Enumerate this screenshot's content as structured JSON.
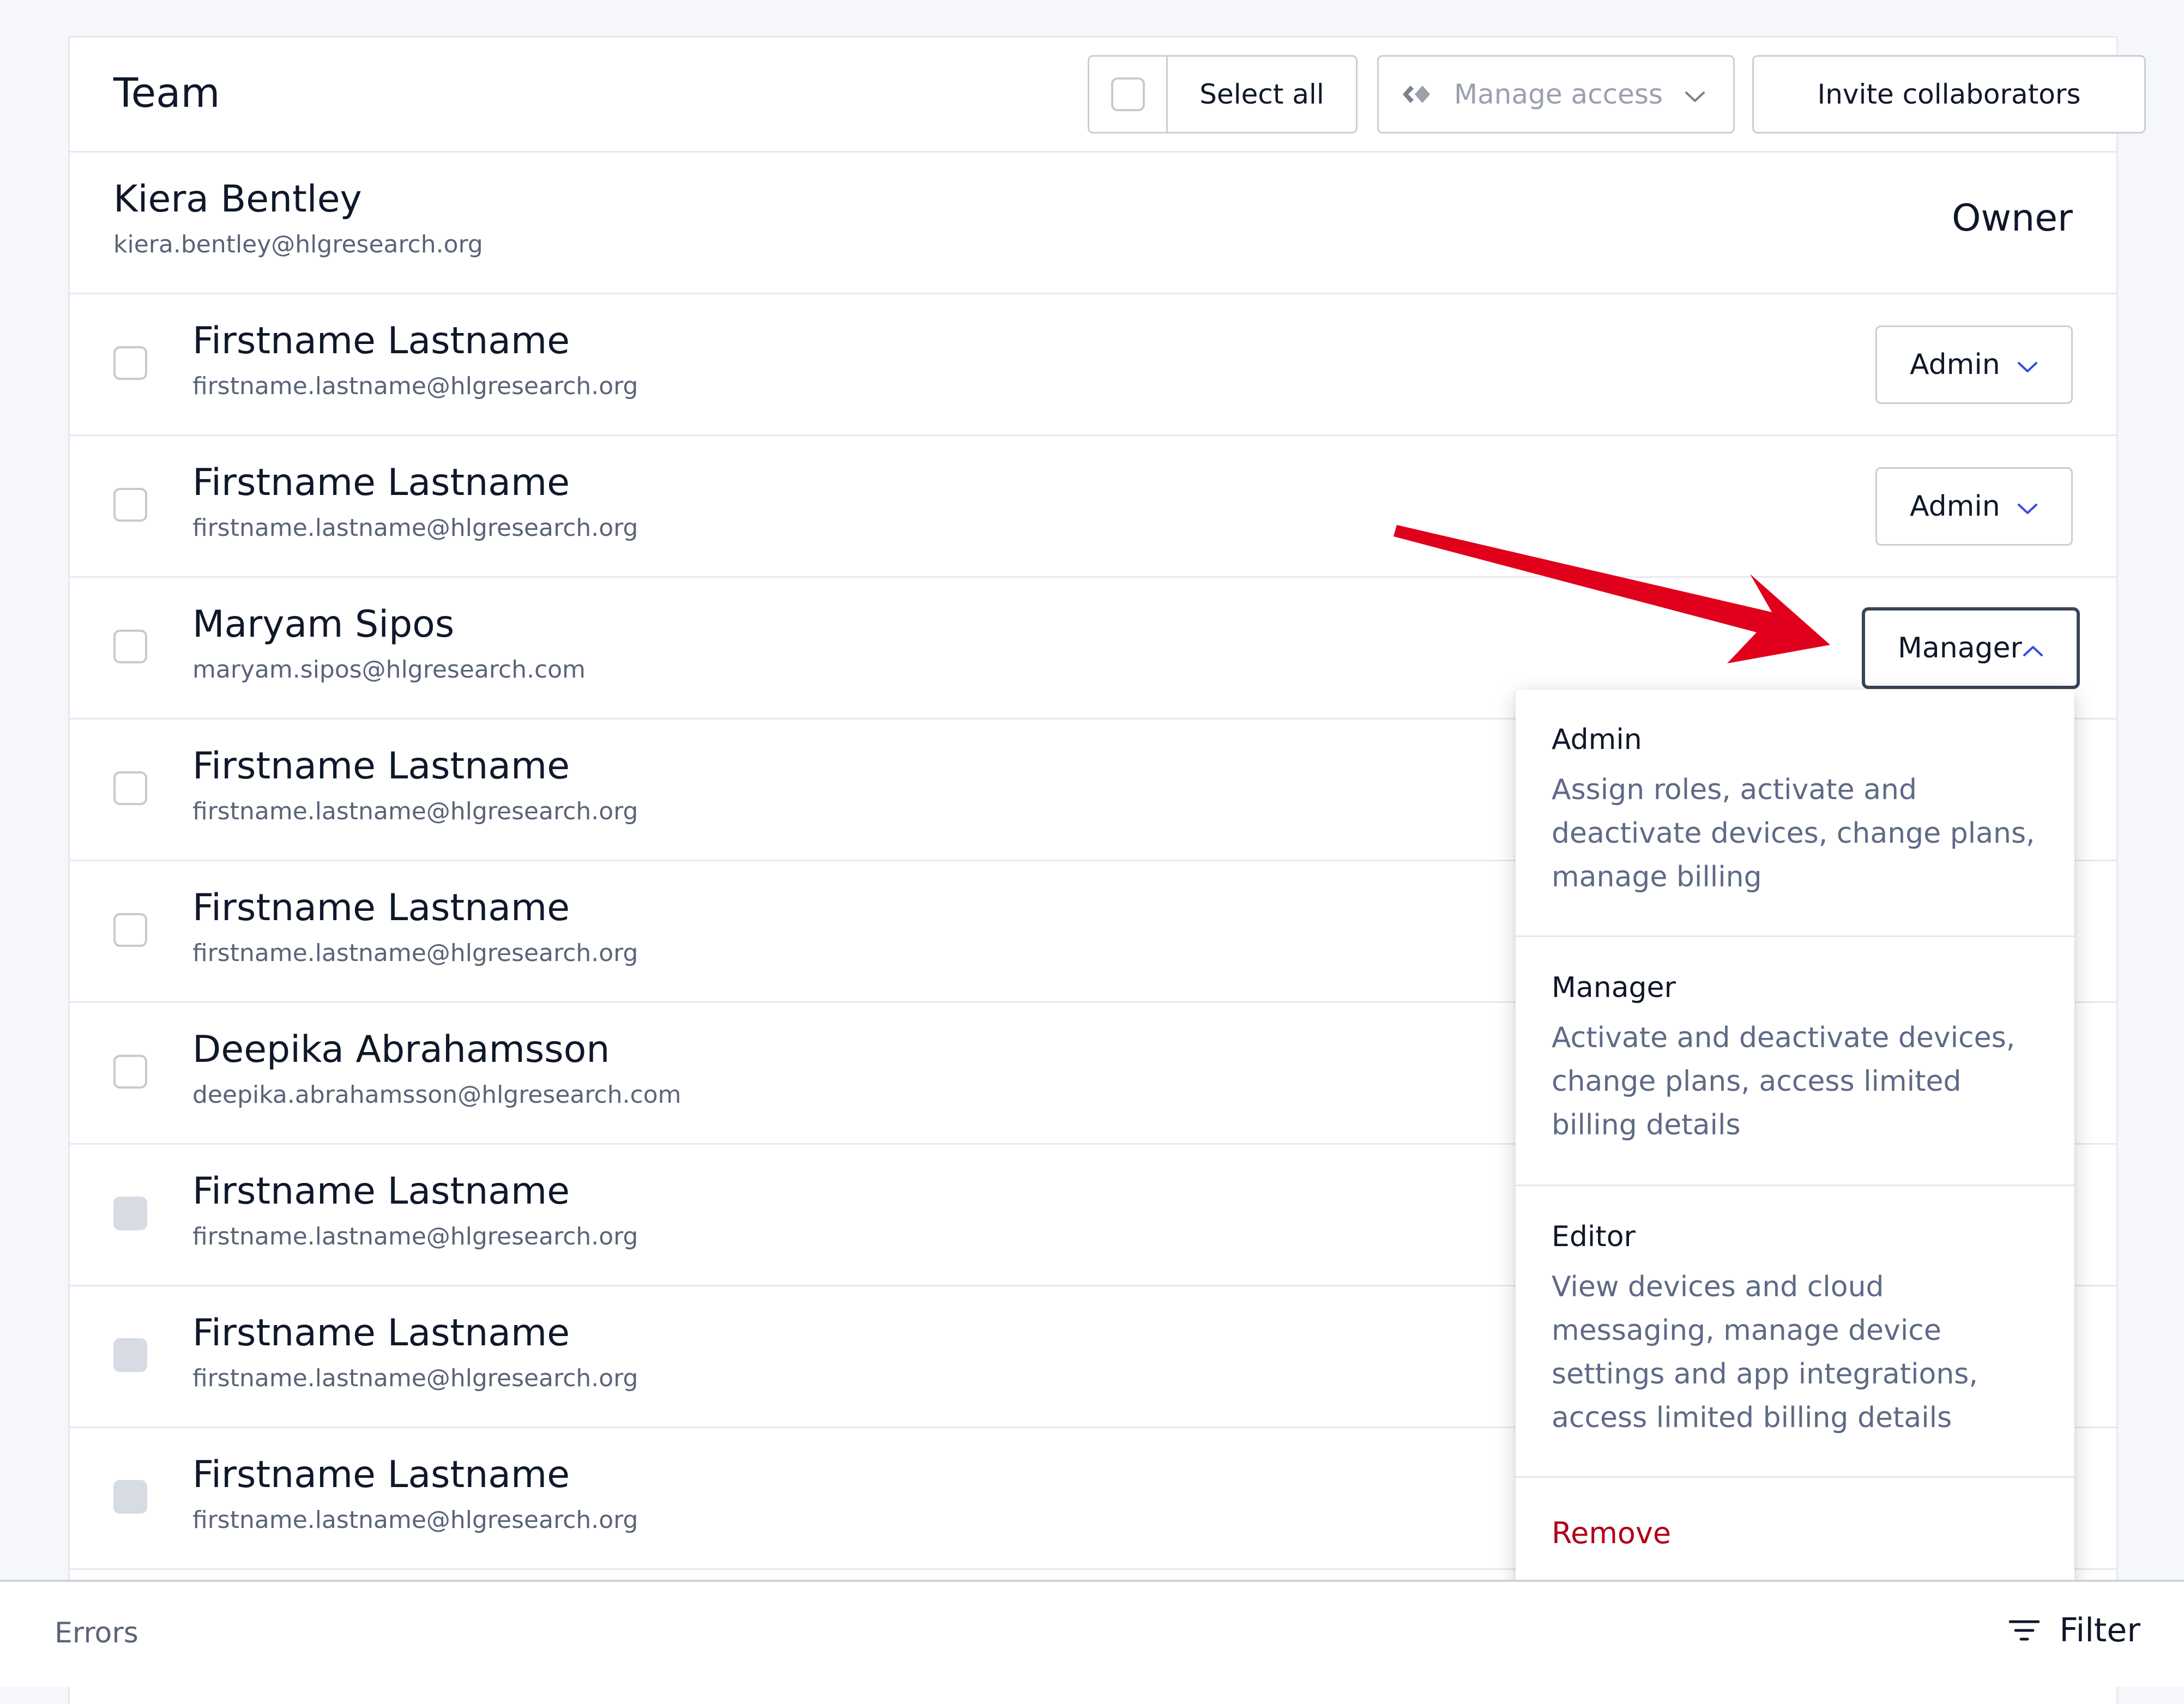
{
  "header": {
    "title": "Team",
    "select_all_label": "Select all",
    "manage_access_label": "Manage access",
    "invite_label": "Invite collaborators"
  },
  "owner": {
    "name": "Kiera Bentley",
    "email": "kiera.bentley@hlgresearch.org",
    "role": "Owner"
  },
  "members": [
    {
      "name": "Firstname Lastname",
      "email": "firstname.lastname@hlgresearch.org",
      "role": "Admin"
    },
    {
      "name": "Firstname Lastname",
      "email": "firstname.lastname@hlgresearch.org",
      "role": "Admin"
    },
    {
      "name": "Maryam Sipos",
      "email": "maryam.sipos@hlgresearch.com",
      "role": "Manager"
    },
    {
      "name": "Firstname Lastname",
      "email": "firstname.lastname@hlgresearch.org"
    },
    {
      "name": "Firstname Lastname",
      "email": "firstname.lastname@hlgresearch.org"
    },
    {
      "name": "Deepika Abrahamsson",
      "email": "deepika.abrahamsson@hlgresearch.com"
    },
    {
      "name": "Firstname Lastname",
      "email": "firstname.lastname@hlgresearch.org"
    },
    {
      "name": "Firstname Lastname",
      "email": "firstname.lastname@hlgresearch.org"
    },
    {
      "name": "Firstname Lastname",
      "email": "firstname.lastname@hlgresearch.org"
    }
  ],
  "role_menu": {
    "options": [
      {
        "title": "Admin",
        "description": "Assign roles, activate and deactivate devices, change plans, manage billing"
      },
      {
        "title": "Manager",
        "description": "Activate and deactivate devices, change plans, access limited billing details"
      },
      {
        "title": "Editor",
        "description": "View devices and cloud messaging, manage device settings and app integrations, access limited billing details"
      }
    ],
    "remove_label": "Remove"
  },
  "footer": {
    "errors_label": "Errors",
    "filter_label": "Filter"
  },
  "colors": {
    "accent": "#3b4be0",
    "danger": "#b00016",
    "annotation_arrow": "#e0001b"
  },
  "icons": [
    "manage-access-icon",
    "chevron-down-icon",
    "chevron-up-icon",
    "filter-icon"
  ]
}
